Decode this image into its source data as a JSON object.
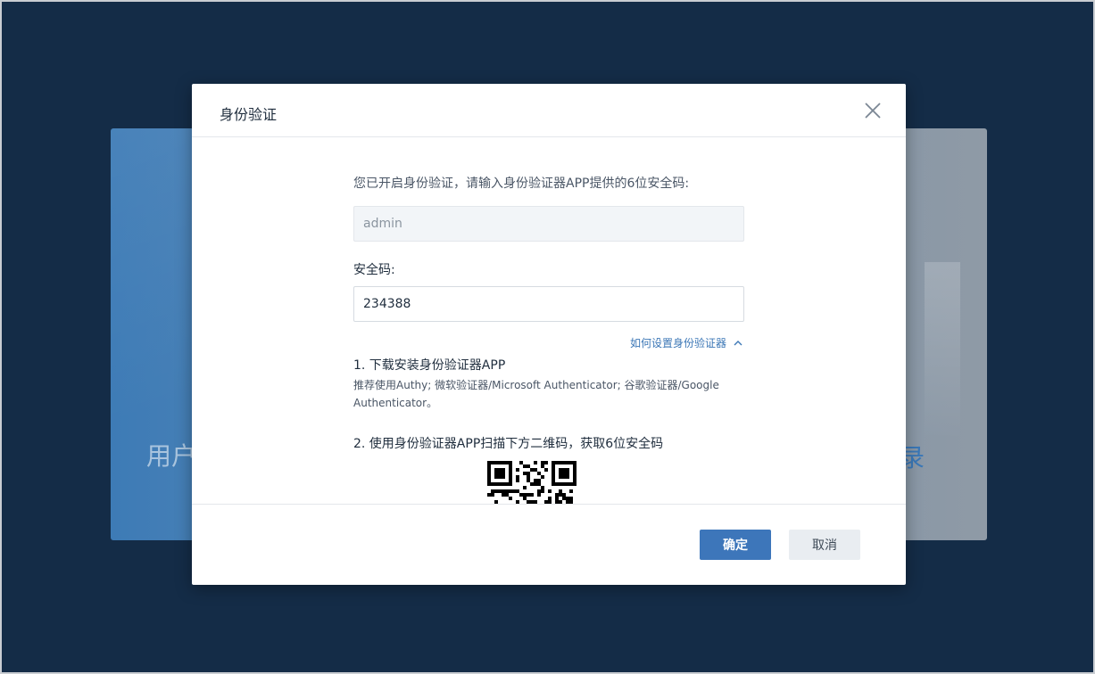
{
  "background": {
    "left_text": "用户",
    "right_text": "录"
  },
  "modal": {
    "title": "身份验证",
    "close_icon": "close-icon",
    "intro": "您已开启身份验证，请输入身份验证器APP提供的6位安全码:",
    "username_value": "admin",
    "code_label": "安全码:",
    "code_value": "234388",
    "help_link": "如何设置身份验证器",
    "help_link_icon": "chevron-up-icon",
    "step1_title": "1. 下载安装身份验证器APP",
    "step1_desc": "推荐使用Authy; 微软验证器/Microsoft Authenticator; 谷歌验证器/Google Authenticator。",
    "step2_title": "2. 使用身份验证器APP扫描下方二维码，获取6位安全码",
    "qr_icon": "qr-code-icon",
    "ok_label": "确定",
    "cancel_label": "取消"
  },
  "colors": {
    "page_bg": "#142c47",
    "primary": "#3d76ba",
    "link": "#3c77b6"
  }
}
